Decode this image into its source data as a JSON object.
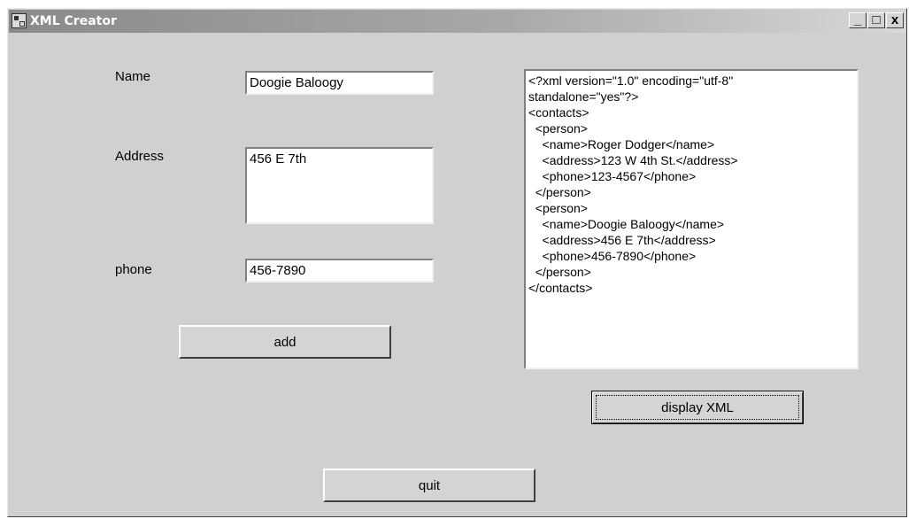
{
  "top_strip_text": "",
  "window": {
    "title": "XML Creator",
    "minimize_label": "_",
    "maximize_label": "□",
    "close_label": "x"
  },
  "form": {
    "name_label": "Name",
    "name_value": "Doogie Baloogy",
    "address_label": "Address",
    "address_value": "456 E 7th",
    "phone_label": "phone",
    "phone_value": "456-7890",
    "add_label": "add",
    "quit_label": "quit"
  },
  "xml_panel": {
    "content": "<?xml version=\"1.0\" encoding=\"utf-8\"\nstandalone=\"yes\"?>\n<contacts>\n  <person>\n    <name>Roger Dodger</name>\n    <address>123 W 4th St.</address>\n    <phone>123-4567</phone>\n  </person>\n  <person>\n    <name>Doogie Baloogy</name>\n    <address>456 E 7th</address>\n    <phone>456-7890</phone>\n  </person>\n</contacts>",
    "display_button_label": "display XML"
  }
}
